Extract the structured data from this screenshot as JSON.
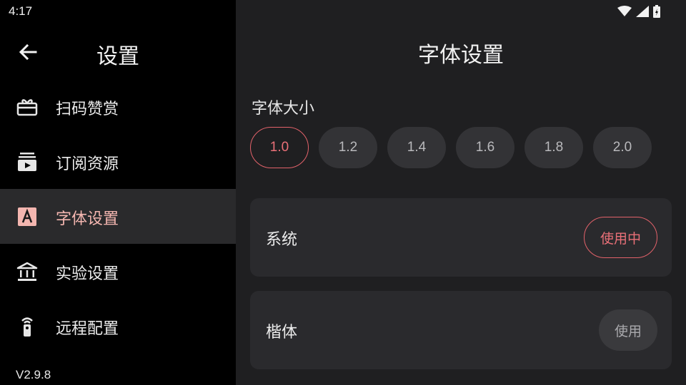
{
  "status": {
    "time": "4:17"
  },
  "sidebar": {
    "title": "设置",
    "items": [
      {
        "label": "扫码赞赏",
        "icon": "gift-icon",
        "active": false
      },
      {
        "label": "订阅资源",
        "icon": "subscriptions-icon",
        "active": false
      },
      {
        "label": "字体设置",
        "icon": "font-icon",
        "active": true
      },
      {
        "label": "实验设置",
        "icon": "bank-icon",
        "active": false
      },
      {
        "label": "远程配置",
        "icon": "remote-icon",
        "active": false
      }
    ],
    "version": "V2.9.8"
  },
  "main": {
    "title": "字体设置",
    "font_size_label": "字体大小",
    "font_sizes": [
      "1.0",
      "1.2",
      "1.4",
      "1.6",
      "1.8",
      "2.0"
    ],
    "selected_size": "1.0",
    "fonts": [
      {
        "name": "系统",
        "button": "使用中",
        "in_use": true
      },
      {
        "name": "楷体",
        "button": "使用",
        "in_use": false
      }
    ]
  },
  "colors": {
    "accent": "#e2626a",
    "active_label": "#f4b6b0",
    "sidebar_bg": "#000000",
    "main_bg": "#1f1f21",
    "card_bg": "#2a2a2d"
  }
}
